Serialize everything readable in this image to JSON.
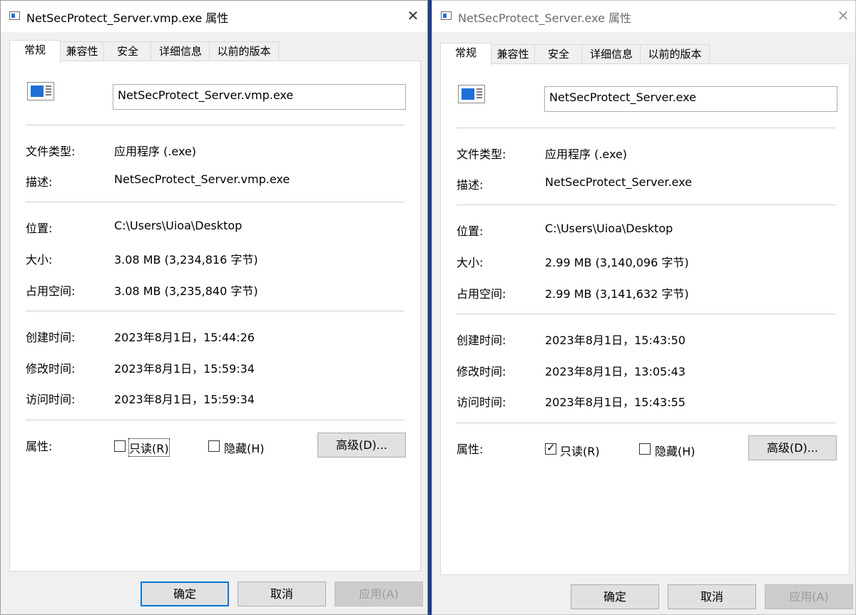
{
  "left": {
    "title": "NetSecProtect_Server.vmp.exe 属性",
    "tabs": [
      "常规",
      "兼容性",
      "安全",
      "详细信息",
      "以前的版本"
    ],
    "filename": "NetSecProtect_Server.vmp.exe",
    "file_type_label": "文件类型:",
    "file_type": "应用程序 (.exe)",
    "desc_label": "描述:",
    "description": "NetSecProtect_Server.vmp.exe",
    "location_label": "位置:",
    "location": "C:\\Users\\Uioa\\Desktop",
    "size_label": "大小:",
    "size": "3.08 MB (3,234,816 字节)",
    "disk_label": "占用空间:",
    "size_on_disk": "3.08 MB (3,235,840 字节)",
    "created_label": "创建时间:",
    "created": "2023年8月1日，15:44:26",
    "modified_label": "修改时间:",
    "modified": "2023年8月1日，15:59:34",
    "accessed_label": "访问时间:",
    "accessed": "2023年8月1日，15:59:34",
    "attr_label": "属性:",
    "readonly_label": "只读(R)",
    "readonly_checked": false,
    "hidden_label": "隐藏(H)",
    "hidden_checked": false,
    "advanced_label": "高级(D)...",
    "ok_label": "确定",
    "cancel_label": "取消",
    "apply_label": "应用(A)"
  },
  "right": {
    "title": "NetSecProtect_Server.exe 属性",
    "tabs": [
      "常规",
      "兼容性",
      "安全",
      "详细信息",
      "以前的版本"
    ],
    "filename": "NetSecProtect_Server.exe",
    "file_type_label": "文件类型:",
    "file_type": "应用程序 (.exe)",
    "desc_label": "描述:",
    "description": "NetSecProtect_Server.exe",
    "location_label": "位置:",
    "location": "C:\\Users\\Uioa\\Desktop",
    "size_label": "大小:",
    "size": "2.99 MB (3,140,096 字节)",
    "disk_label": "占用空间:",
    "size_on_disk": "2.99 MB (3,141,632 字节)",
    "created_label": "创建时间:",
    "created": "2023年8月1日，15:43:50",
    "modified_label": "修改时间:",
    "modified": "2023年8月1日，13:05:43",
    "accessed_label": "访问时间:",
    "accessed": "2023年8月1日，15:43:55",
    "attr_label": "属性:",
    "readonly_label": "只读(R)",
    "readonly_checked": true,
    "hidden_label": "隐藏(H)",
    "hidden_checked": false,
    "advanced_label": "高级(D)...",
    "ok_label": "确定",
    "cancel_label": "取消",
    "apply_label": "应用(A)"
  },
  "icons": {
    "title": "app-window-icon",
    "file": "exe-file-icon",
    "close": "close-icon",
    "check": "checkmark-icon"
  },
  "close_glyph": "✕"
}
